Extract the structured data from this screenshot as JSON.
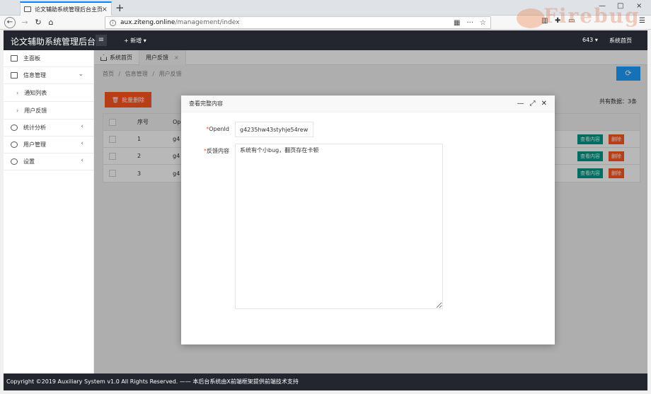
{
  "browser": {
    "tab_title": "论文辅助系统管理后台主页",
    "tab_close": "×",
    "new_tab": "+",
    "url_host": "aux.ziteng.online",
    "url_path": "/management/index",
    "url_more": "···",
    "bookmark": "☆",
    "logo_text": "Firebug",
    "minimize": "—",
    "maximize": "□",
    "close": "×"
  },
  "app": {
    "title": "论文辅助系统管理后台",
    "add_new": "+ 新增 ▾",
    "user_id": "643 ▾",
    "home_link": "系统首页"
  },
  "sidebar": {
    "items": [
      {
        "label": "主面板"
      },
      {
        "label": "信息管理",
        "arrow": "⌄"
      },
      {
        "label": "通知列表"
      },
      {
        "label": "用户反馈"
      },
      {
        "label": "统计分析",
        "arrow": "‹"
      },
      {
        "label": "用户管理",
        "arrow": "‹"
      },
      {
        "label": "设置",
        "arrow": "‹"
      }
    ]
  },
  "tabs": {
    "home": "系统首页",
    "feedback": "用户反馈",
    "close": "×"
  },
  "breadcrumb": [
    "首页",
    "/",
    "信息管理",
    "/",
    "用户反馈"
  ],
  "toolbar": {
    "bulk_delete": "批量删除",
    "total": "共有数据：3条"
  },
  "table": {
    "headers": {
      "index": "序号",
      "openid": "Op"
    },
    "rows": [
      {
        "index": "1",
        "openid": "g4"
      },
      {
        "index": "2",
        "openid": "g4"
      },
      {
        "index": "3",
        "openid": "g4"
      }
    ],
    "view_label": "查看内容",
    "delete_label": "删除"
  },
  "modal": {
    "title": "查看完整内容",
    "openid_label": "OpenId",
    "openid_value": "g4235hw43styhje54rew",
    "content_label": "反馈内容",
    "content_value": "系统有个小bug，翻页存在卡顿",
    "required_mark": "*"
  },
  "footer": {
    "text": "Copyright ©2019 Auxiliary System v1.0 All Rights Reserved. —— 本后台系统由X前端框架提供前端技术支持"
  },
  "colors": {
    "topbar": "#23262e",
    "danger": "#ff5722",
    "primary": "#1e9fff",
    "success": "#009688"
  }
}
